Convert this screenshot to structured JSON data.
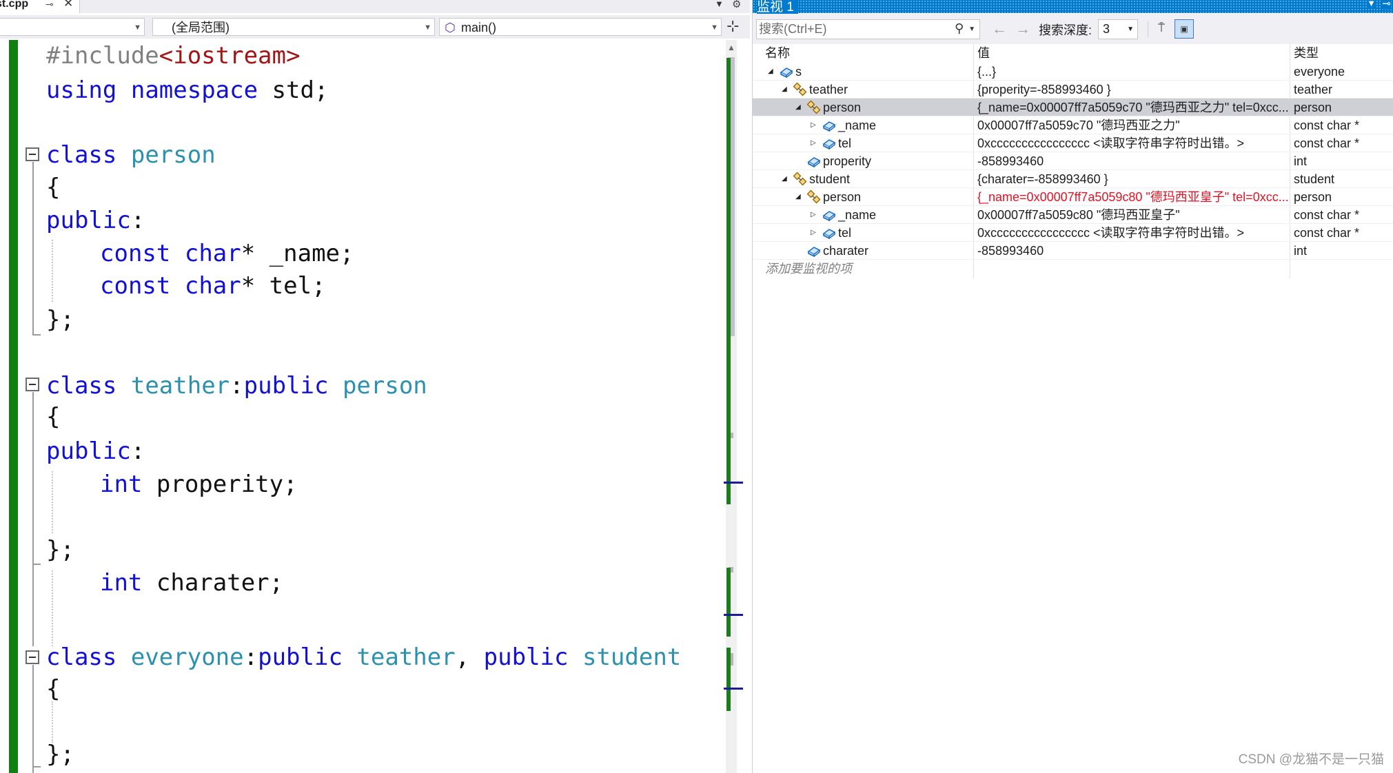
{
  "editor": {
    "tab_title": "st.cpp",
    "nav_scope": "",
    "nav_global": "(全局范围)",
    "nav_function": "main()",
    "code": {
      "l1_pp": "#include",
      "l1_str": "<iostream>",
      "l2_kw1": "using",
      "l2_kw2": "namespace",
      "l2_rest": " std;",
      "c1_kw": "class",
      "c1_name": "person",
      "brace_open": "{",
      "public_kw": "public",
      "colon": ":",
      "m1_kw": "const",
      "m1_kw2": "char",
      "m1_rest": "* _name;",
      "m2_kw": "const",
      "m2_kw2": "char",
      "m2_rest": "* tel;",
      "brace_close": "};",
      "c2_kw": "class",
      "c2_name": "teather",
      "c2_sep": ":",
      "c2_pub": "public",
      "c2_base": "person",
      "m3_kw": "int",
      "m3_rest": " properity;",
      "m4_kw": "int",
      "m4_rest": " charater;",
      "c3_kw": "class",
      "c3_name": "everyone",
      "c3_sep": ":",
      "c3_pub1": "public",
      "c3_base1": "teather",
      "c3_comma": ", ",
      "c3_pub2": "public",
      "c3_base2": "student"
    }
  },
  "watch": {
    "title": "监视 1",
    "search_placeholder": "搜索(Ctrl+E)",
    "depth_label": "搜索深度:",
    "depth_value": "3",
    "col_name": "名称",
    "col_value": "值",
    "col_type": "类型",
    "rows": [
      {
        "name": "s",
        "value": "{...}",
        "type": "everyone",
        "icon": "variable-icon"
      },
      {
        "name": "teather",
        "value": "{properity=-858993460 }",
        "type": "teather",
        "icon": "base-class-icon"
      },
      {
        "name": "person",
        "value": "{_name=0x00007ff7a5059c70 \"德玛西亚之力\" tel=0xcc...",
        "type": "person",
        "icon": "base-class-icon"
      },
      {
        "name": "_name",
        "value": "0x00007ff7a5059c70 \"德玛西亚之力\"",
        "type": "const char *",
        "icon": "variable-icon"
      },
      {
        "name": "tel",
        "value": "0xcccccccccccccccc <读取字符串字符时出错。>",
        "type": "const char *",
        "icon": "variable-icon"
      },
      {
        "name": "properity",
        "value": "-858993460",
        "type": "int",
        "icon": "variable-icon"
      },
      {
        "name": "student",
        "value": "{charater=-858993460 }",
        "type": "student",
        "icon": "base-class-icon"
      },
      {
        "name": "person",
        "value": "{_name=0x00007ff7a5059c80 \"德玛西亚皇子\" tel=0xcc...",
        "type": "person",
        "icon": "base-class-icon",
        "value_color": "#e81123"
      },
      {
        "name": "_name",
        "value": "0x00007ff7a5059c80 \"德玛西亚皇子\"",
        "type": "const char *",
        "icon": "variable-icon"
      },
      {
        "name": "tel",
        "value": "0xcccccccccccccccc <读取字符串字符时出错。>",
        "type": "const char *",
        "icon": "variable-icon"
      },
      {
        "name": "charater",
        "value": "-858993460",
        "type": "int",
        "icon": "variable-icon"
      }
    ],
    "add_watch": "添加要监视的项"
  },
  "credit": "CSDN @龙猫不是一只猫"
}
